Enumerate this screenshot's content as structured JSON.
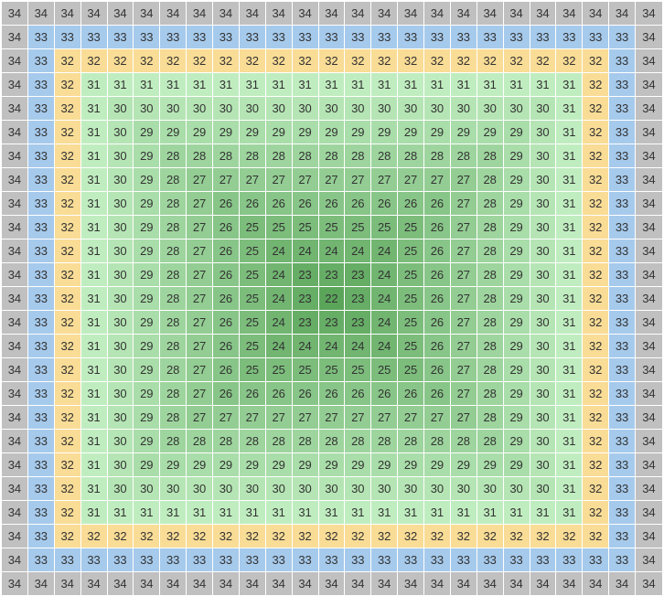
{
  "chart_data": {
    "type": "heatmap",
    "rows": 25,
    "cols": 25,
    "center": {
      "row": 12,
      "col": 12,
      "value": 22
    },
    "values_note": "value = 22 + chebyshev-distance from center; range 22–34",
    "palette": [
      {
        "v": 22,
        "color": "#5ba55b"
      },
      {
        "v": 23,
        "color": "#66ad66"
      },
      {
        "v": 24,
        "color": "#71b571"
      },
      {
        "v": 25,
        "color": "#7cbd7c"
      },
      {
        "v": 26,
        "color": "#88c588"
      },
      {
        "v": 27,
        "color": "#93cd93"
      },
      {
        "v": 28,
        "color": "#9ed59e"
      },
      {
        "v": 29,
        "color": "#a9dda9"
      },
      {
        "v": 30,
        "color": "#b5e5b4"
      },
      {
        "v": 31,
        "color": "#c0edc0"
      },
      {
        "v": 32,
        "color": "#f9dc95"
      },
      {
        "v": 33,
        "color": "#a6caec"
      },
      {
        "v": 34,
        "color": "#c0c0c0"
      }
    ]
  }
}
